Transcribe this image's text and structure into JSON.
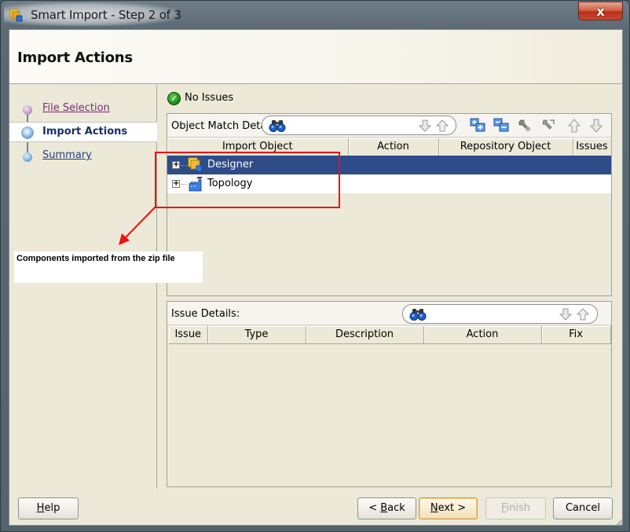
{
  "window": {
    "title": "Smart Import - Step 2 of 3",
    "close_label": "x"
  },
  "header": {
    "title": "Import Actions"
  },
  "nav": {
    "steps": [
      {
        "label": "File Selection",
        "state": "visited"
      },
      {
        "label": "Import Actions",
        "state": "current"
      },
      {
        "label": "Summary",
        "state": "future"
      }
    ]
  },
  "status": {
    "icon": "check-circle-icon",
    "text": "No Issues"
  },
  "object_match": {
    "title": "Object Match Details",
    "search_value": "",
    "toolbar": [
      {
        "name": "expand-all",
        "icon": "expand-all-icon"
      },
      {
        "name": "collapse-all",
        "icon": "collapse-all-icon"
      },
      {
        "name": "resolve",
        "icon": "wrench-icon"
      },
      {
        "name": "resolve-all",
        "icon": "wrench-all-icon"
      },
      {
        "name": "move-up",
        "icon": "arrow-up-icon"
      },
      {
        "name": "move-down",
        "icon": "arrow-down-icon"
      }
    ],
    "columns": [
      "Import Object",
      "Action",
      "Repository Object",
      "Issues"
    ],
    "rows": [
      {
        "label": "Designer",
        "icon": "designer-icon",
        "selected": true,
        "expander": "+"
      },
      {
        "label": "Topology",
        "icon": "topology-icon",
        "selected": false,
        "expander": "+"
      }
    ]
  },
  "issue_details": {
    "title": "Issue Details:",
    "search_value": "",
    "columns": [
      "Issue",
      "Type",
      "Description",
      "Action",
      "Fix"
    ],
    "rows": []
  },
  "annotation": {
    "callout_text": "Components imported from the zip file",
    "color": "#ee1111"
  },
  "buttons": {
    "help": {
      "label": "Help",
      "mnemonic": "H"
    },
    "back": {
      "label": "< Back",
      "mnemonic": "B"
    },
    "next": {
      "label": "Next >",
      "mnemonic": "N"
    },
    "finish": {
      "label": "Finish",
      "mnemonic": "F",
      "disabled": true
    },
    "cancel": {
      "label": "Cancel"
    }
  }
}
